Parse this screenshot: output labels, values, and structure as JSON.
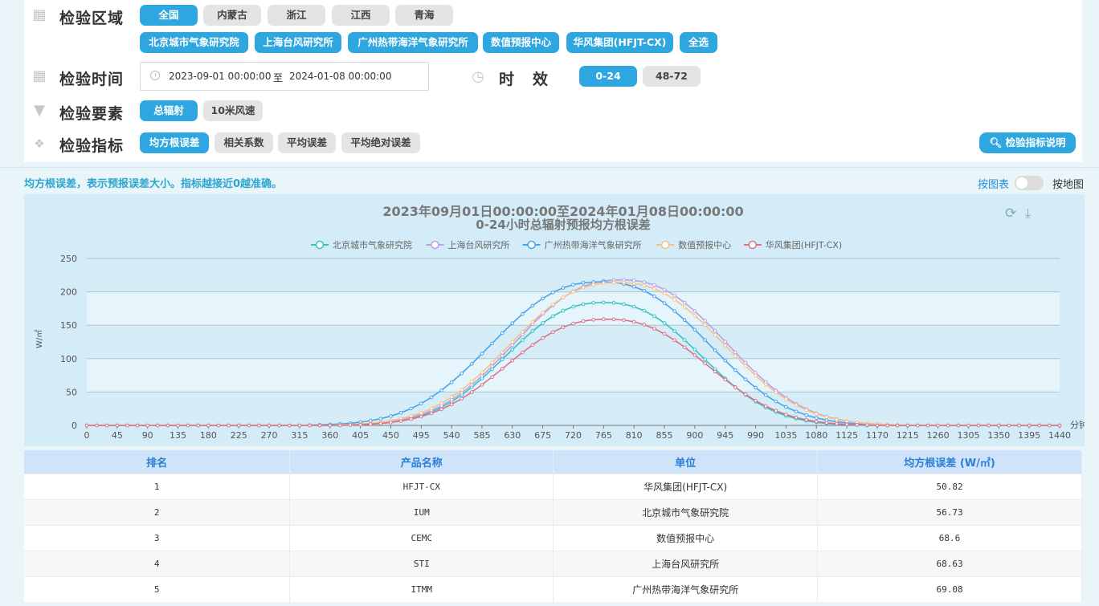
{
  "filters": {
    "region": {
      "label": "检验区域",
      "options": [
        {
          "label": "全国",
          "active": true
        },
        {
          "label": "内蒙古",
          "active": false
        },
        {
          "label": "浙江",
          "active": false
        },
        {
          "label": "江西",
          "active": false
        },
        {
          "label": "青海",
          "active": false
        }
      ],
      "units": [
        {
          "label": "北京城市气象研究院",
          "active": true
        },
        {
          "label": "上海台风研究所",
          "active": true
        },
        {
          "label": "广州热带海洋气象研究所",
          "active": true
        },
        {
          "label": "数值预报中心",
          "active": true
        },
        {
          "label": "华风集团(HFJT-CX)",
          "active": true
        },
        {
          "label": "全选",
          "active": true
        }
      ]
    },
    "time": {
      "label": "检验时间",
      "start": "2023-09-01 00:00:00",
      "separator": "至",
      "end": "2024-01-08 00:00:00"
    },
    "validity": {
      "label": "时　效",
      "options": [
        {
          "label": "0-24",
          "active": true
        },
        {
          "label": "48-72",
          "active": false
        }
      ]
    },
    "element": {
      "label": "检验要素",
      "options": [
        {
          "label": "总辐射",
          "active": true
        },
        {
          "label": "10米风速",
          "active": false
        }
      ]
    },
    "metric": {
      "label": "检验指标",
      "options": [
        {
          "label": "均方根误差",
          "active": true
        },
        {
          "label": "相关系数",
          "active": false
        },
        {
          "label": "平均误差",
          "active": false
        },
        {
          "label": "平均绝对误差",
          "active": false
        }
      ],
      "help_button": "检验指标说明"
    }
  },
  "note": "均方根误差，表示预报误差大小。指标越接近0越准确。",
  "view_toggle": {
    "left": "按图表",
    "right": "按地图",
    "on": false
  },
  "chart_data": {
    "type": "line",
    "title": "2023年09月01日00:00:00至2024年01月08日00:00:00",
    "subtitle": "0-24小时总辐射预报均方根误差",
    "xlabel": "分钟",
    "ylabel": "W/㎡",
    "ylim": [
      0,
      250
    ],
    "yticks": [
      0,
      50,
      100,
      150,
      200,
      250
    ],
    "xlim": [
      0,
      1440
    ],
    "xticks": [
      0,
      45,
      90,
      135,
      180,
      225,
      270,
      315,
      360,
      405,
      450,
      495,
      540,
      585,
      630,
      675,
      720,
      765,
      810,
      855,
      900,
      945,
      990,
      1035,
      1080,
      1125,
      1170,
      1215,
      1260,
      1305,
      1350,
      1395,
      1440
    ],
    "x_step": 15,
    "legend_position": "top-center",
    "grid": true,
    "series": [
      {
        "name": "北京城市气象研究院",
        "color": "#35c3c4",
        "peak": 184,
        "center": 765,
        "width": 175,
        "offset": 0
      },
      {
        "name": "上海台风研究所",
        "color": "#b9a1e6",
        "peak": 218,
        "center": 790,
        "width": 190,
        "offset": 0
      },
      {
        "name": "广州热带海洋气象研究所",
        "color": "#4aa3ea",
        "peak": 215,
        "center": 760,
        "width": 195,
        "offset": 0
      },
      {
        "name": "数值预报中心",
        "color": "#f5c18a",
        "peak": 214,
        "center": 785,
        "width": 192,
        "offset": 0
      },
      {
        "name": "华风集团(HFJT-CX)",
        "color": "#d9738a",
        "peak": 159,
        "center": 770,
        "width": 180,
        "offset": 0
      }
    ]
  },
  "table": {
    "headers": [
      "排名",
      "产品名称",
      "单位",
      "均方根误差 (W/㎡)"
    ],
    "rows": [
      [
        "1",
        "HFJT-CX",
        "华风集团(HFJT-CX)",
        "50.82"
      ],
      [
        "2",
        "IUM",
        "北京城市气象研究院",
        "56.73"
      ],
      [
        "3",
        "CEMC",
        "数值预报中心",
        "68.6"
      ],
      [
        "4",
        "STI",
        "上海台风研究所",
        "68.63"
      ],
      [
        "5",
        "ITMM",
        "广州热带海洋气象研究所",
        "69.08"
      ]
    ]
  },
  "icons": {
    "region": "calendar-icon",
    "time": "calendar-icon",
    "validity": "clock-icon",
    "element": "filter-icon",
    "metric": "cubes-icon",
    "help": "search-icon",
    "refresh": "refresh-icon",
    "download": "download-icon"
  }
}
